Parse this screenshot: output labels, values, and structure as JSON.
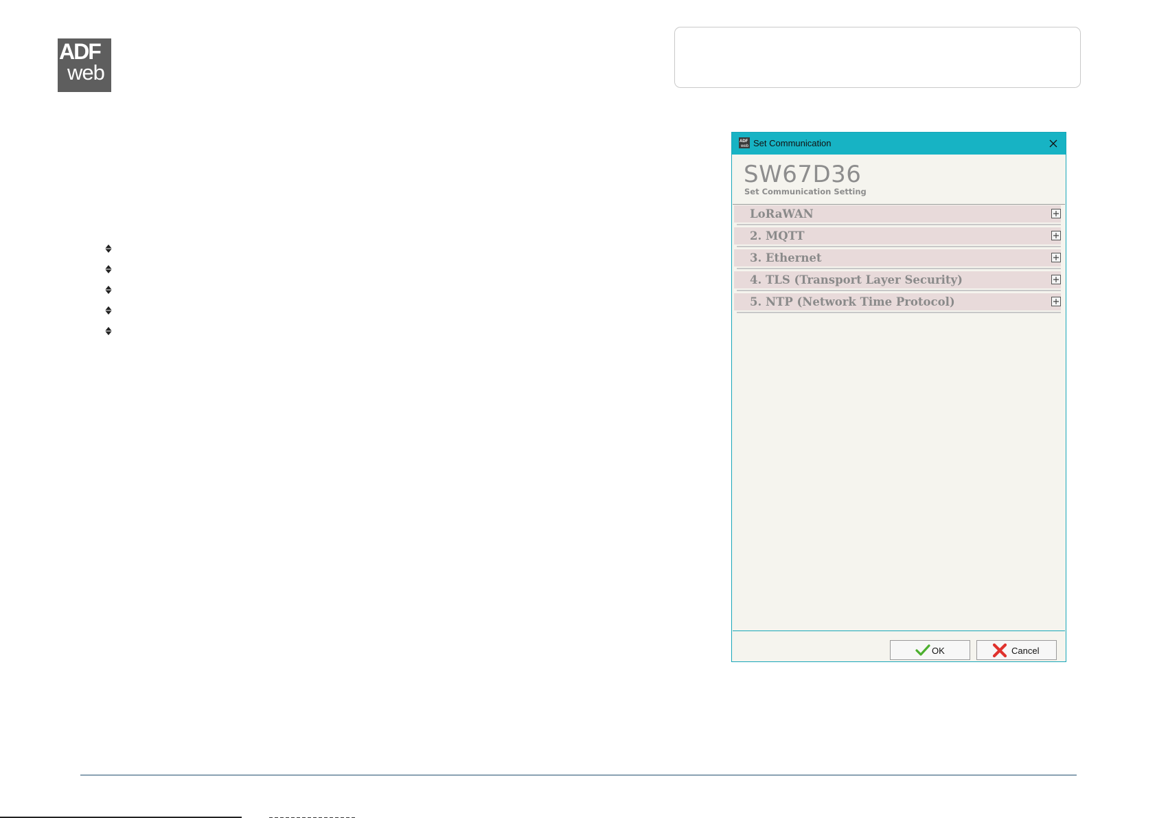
{
  "logo": {
    "text_top": "ADF",
    "text_bottom": "web",
    "background": "#5e5e5e"
  },
  "bullets": {
    "count": 5,
    "icon": "diamond-bullet-icon"
  },
  "dialog": {
    "title": "Set Communication",
    "app_icon": "adfweb-icon",
    "close_icon": "close-icon",
    "device_name": "SW67D36",
    "subtitle": "Set Communication Setting",
    "sections": [
      {
        "label": "LoRaWAN"
      },
      {
        "label": "2. MQTT"
      },
      {
        "label": "3. Ethernet"
      },
      {
        "label": "4. TLS (Transport Layer Security)"
      },
      {
        "label": "5. NTP (Network Time Protocol)"
      }
    ],
    "ok_label": "OK",
    "cancel_label": "Cancel",
    "colors": {
      "titlebar": "#17b3c4",
      "section_bar": "#e8dada",
      "panel_background": "#f5f4ee"
    }
  }
}
